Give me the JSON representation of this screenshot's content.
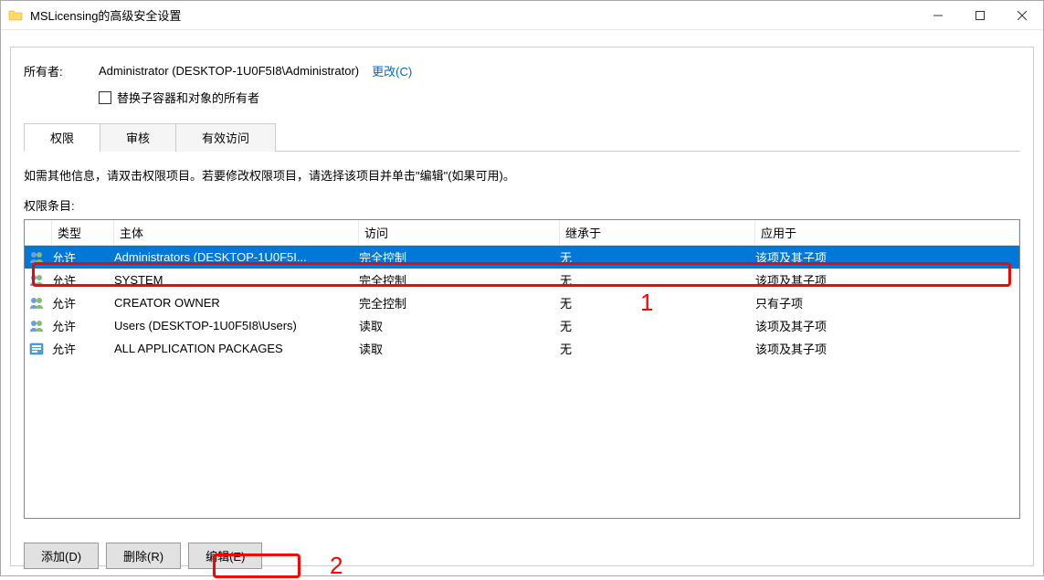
{
  "window": {
    "title": "MSLicensing的高级安全设置"
  },
  "owner": {
    "label": "所有者:",
    "value": "Administrator (DESKTOP-1U0F5I8\\Administrator)",
    "change_link": "更改(C)",
    "replace_checkbox_label": "替换子容器和对象的所有者"
  },
  "tabs": [
    {
      "label": "权限",
      "active": true
    },
    {
      "label": "审核",
      "active": false
    },
    {
      "label": "有效访问",
      "active": false
    }
  ],
  "instructions": "如需其他信息，请双击权限项目。若要修改权限项目，请选择该项目并单击\"编辑\"(如果可用)。",
  "entries_label": "权限条目:",
  "columns": {
    "type": "类型",
    "principal": "主体",
    "access": "访问",
    "inherited": "继承于",
    "applies": "应用于"
  },
  "entries": [
    {
      "icon": "group",
      "type": "允许",
      "principal": "Administrators (DESKTOP-1U0F5I...",
      "access": "完全控制",
      "inherited": "无",
      "applies": "该项及其子项",
      "selected": true
    },
    {
      "icon": "group",
      "type": "允许",
      "principal": "SYSTEM",
      "access": "完全控制",
      "inherited": "无",
      "applies": "该项及其子项",
      "selected": false
    },
    {
      "icon": "group",
      "type": "允许",
      "principal": "CREATOR OWNER",
      "access": "完全控制",
      "inherited": "无",
      "applies": "只有子项",
      "selected": false
    },
    {
      "icon": "group",
      "type": "允许",
      "principal": "Users (DESKTOP-1U0F5I8\\Users)",
      "access": "读取",
      "inherited": "无",
      "applies": "该项及其子项",
      "selected": false
    },
    {
      "icon": "package",
      "type": "允许",
      "principal": "ALL APPLICATION PACKAGES",
      "access": "读取",
      "inherited": "无",
      "applies": "该项及其子项",
      "selected": false
    }
  ],
  "buttons": {
    "add": "添加(D)",
    "remove": "删除(R)",
    "edit": "编辑(E)"
  },
  "annotations": {
    "one": "1",
    "two": "2"
  }
}
